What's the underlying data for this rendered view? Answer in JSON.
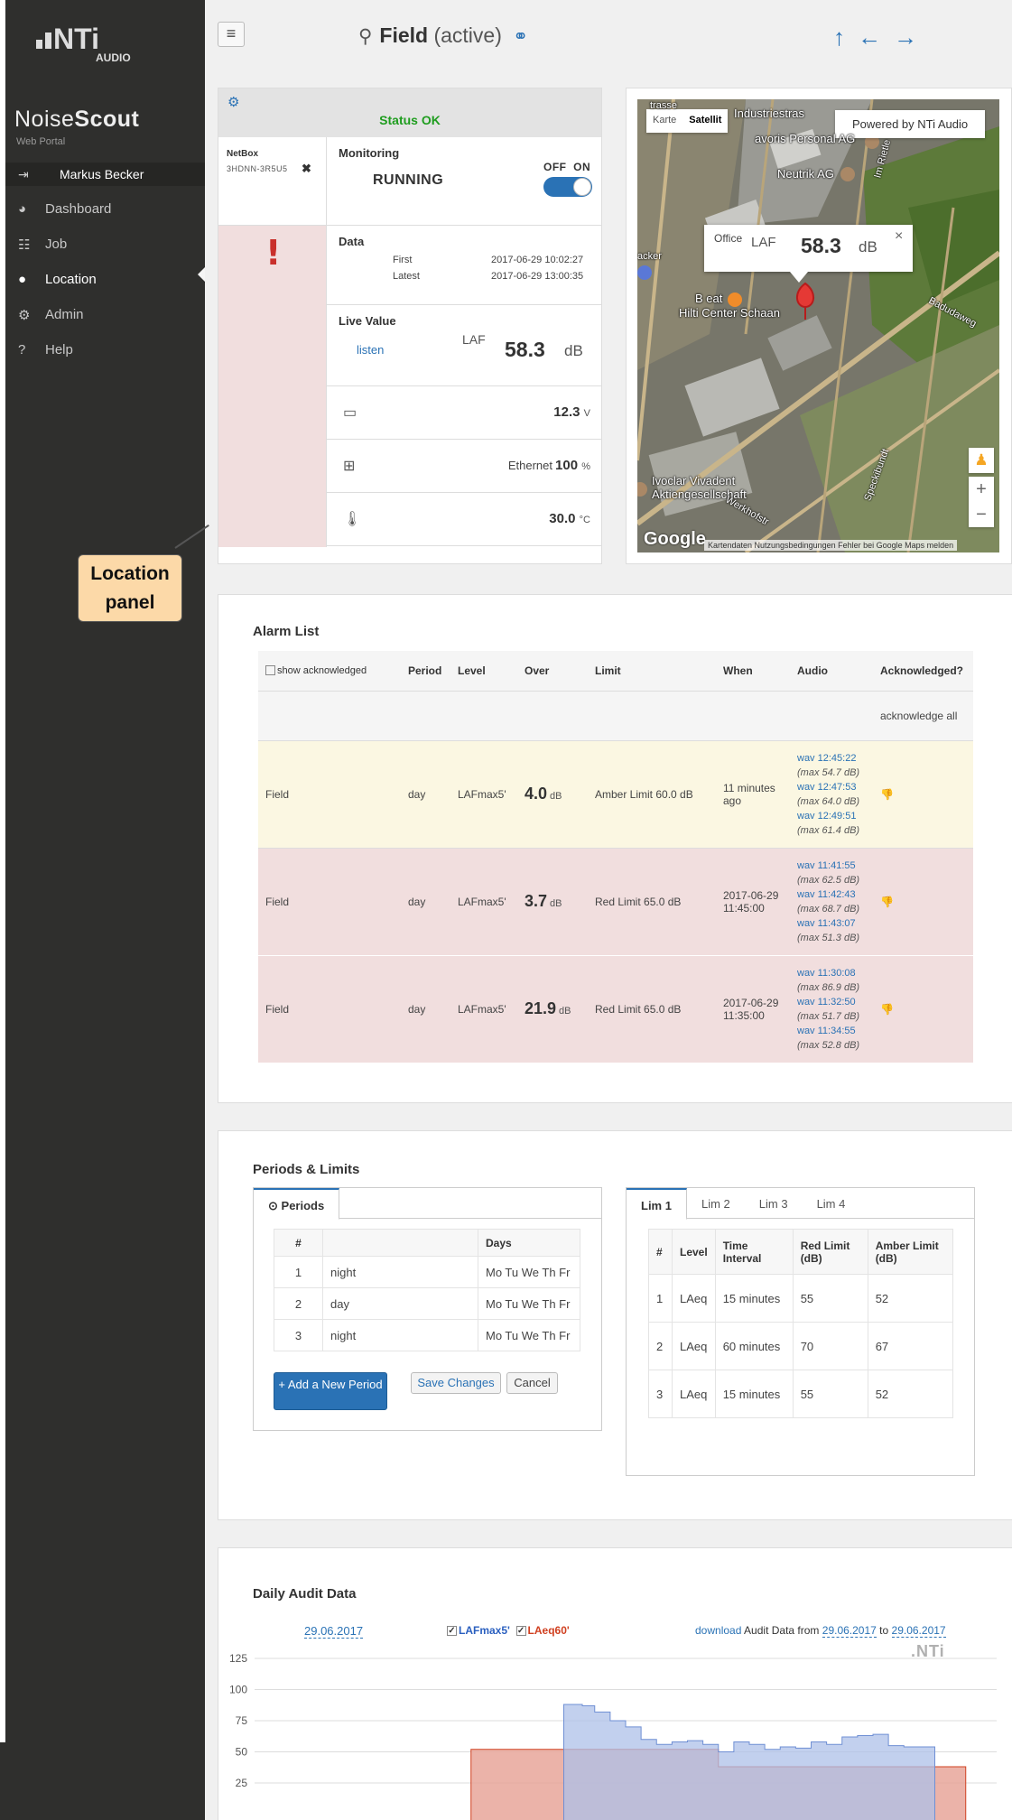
{
  "brand": {
    "logo_text": "NTi",
    "logo_sub": "AUDIO",
    "name_light": "Noise",
    "name_bold": "Scout",
    "subtitle": "Web Portal"
  },
  "user": {
    "name": "Markus Becker",
    "icon": "sign-in-icon"
  },
  "nav": {
    "items": [
      {
        "label": "Dashboard",
        "icon": "dashboard-icon"
      },
      {
        "label": "Job",
        "icon": "grid-icon"
      },
      {
        "label": "Location",
        "icon": "map-pin-icon",
        "active": true
      },
      {
        "label": "Admin",
        "icon": "gears-icon"
      },
      {
        "label": "Help",
        "icon": "question-icon"
      }
    ]
  },
  "header": {
    "title": "Field",
    "state": "(active)",
    "nav_arrows": [
      "up-arrow-icon",
      "left-arrow-icon",
      "right-arrow-icon"
    ]
  },
  "status": {
    "status_text": "Status OK",
    "netbox_label": "NetBox",
    "netbox_id": "3HDNN-3R5U5",
    "remove_icon": "✖",
    "alarm_icon": "!",
    "monitoring_label": "Monitoring",
    "monitoring_state": "RUNNING",
    "toggle_off": "OFF",
    "toggle_on": "ON",
    "toggle_value": "on",
    "data_label": "Data",
    "first_label": "First",
    "first_value": "2017-06-29 10:02:27",
    "latest_label": "Latest",
    "latest_value": "2017-06-29 13:00:35",
    "live_label": "Live Value",
    "listen_label": "listen",
    "live_metric": "LAF",
    "live_value": "58.3",
    "live_unit": "dB",
    "battery_value": "12.3",
    "battery_unit": "V",
    "network_label": "Ethernet",
    "network_value": "100",
    "network_unit": "%",
    "temp_value": "30.0",
    "temp_unit": "°C"
  },
  "map": {
    "type_map": "Karte",
    "type_sat": "Satellit",
    "powered": "Powered by NTi Audio",
    "info_name": "Office",
    "info_metric": "LAF",
    "info_value": "58.3",
    "info_unit": "dB",
    "labels": [
      "Industriestras",
      "avoris Personal AG",
      "Neutrik AG",
      "B eat",
      "Hilti Center Schaan",
      "Ivoclar Vivadent Aktiengesellschaft",
      "Badudaweg",
      "trasse",
      "acker",
      "Speckibundt",
      "Im Rietle",
      "Werkhofstr"
    ],
    "google": "Google",
    "terms": "Kartendaten   Nutzungsbedingungen   Fehler bei Google Maps melden",
    "zoom_in": "+",
    "zoom_out": "−"
  },
  "callout": {
    "line1": "Location",
    "line2": "panel"
  },
  "alarms": {
    "title": "Alarm List",
    "show_ack_label": "show acknowledged",
    "headers": [
      "Period",
      "Level",
      "Over",
      "Limit",
      "When",
      "Audio",
      "Acknowledged?"
    ],
    "ack_all": "acknowledge all",
    "rows": [
      {
        "location": "Field",
        "period": "day",
        "level": "LAFmax5'",
        "over": "4.0",
        "over_unit": "dB",
        "limit": "Amber Limit 60.0 dB",
        "when": "11 minutes ago",
        "audio": [
          {
            "wav": "wav 12:45:22",
            "max": "(max 54.7 dB)"
          },
          {
            "wav": "wav 12:47:53",
            "max": "(max 64.0 dB)"
          },
          {
            "wav": "wav 12:49:51",
            "max": "(max 61.4 dB)"
          }
        ]
      },
      {
        "location": "Field",
        "period": "day",
        "level": "LAFmax5'",
        "over": "3.7",
        "over_unit": "dB",
        "limit": "Red Limit 65.0 dB",
        "when": "2017-06-29 11:45:00",
        "audio": [
          {
            "wav": "wav 11:41:55",
            "max": "(max 62.5 dB)"
          },
          {
            "wav": "wav 11:42:43",
            "max": "(max 68.7 dB)"
          },
          {
            "wav": "wav 11:43:07",
            "max": "(max 51.3 dB)"
          }
        ]
      },
      {
        "location": "Field",
        "period": "day",
        "level": "LAFmax5'",
        "over": "21.9",
        "over_unit": "dB",
        "limit": "Red Limit 65.0 dB",
        "when": "2017-06-29 11:35:00",
        "audio": [
          {
            "wav": "wav 11:30:08",
            "max": "(max 86.9 dB)"
          },
          {
            "wav": "wav 11:32:50",
            "max": "(max 51.7 dB)"
          },
          {
            "wav": "wav 11:34:55",
            "max": "(max 52.8 dB)"
          }
        ]
      }
    ]
  },
  "periods": {
    "title": "Periods & Limits",
    "tab_label": "Periods",
    "headers": [
      "#",
      "",
      "Days"
    ],
    "rows": [
      {
        "n": "1",
        "name": "night",
        "days": "Mo Tu We Th Fr"
      },
      {
        "n": "2",
        "name": "day",
        "days": "Mo Tu We Th Fr"
      },
      {
        "n": "3",
        "name": "night",
        "days": "Mo Tu We Th Fr"
      }
    ],
    "add_btn": "+ Add a New Period",
    "save_btn": "Save Changes",
    "cancel_btn": "Cancel"
  },
  "limits": {
    "tabs": [
      "Lim 1",
      "Lim 2",
      "Lim 3",
      "Lim 4"
    ],
    "headers": [
      "#",
      "Level",
      "Time Interval",
      "Red Limit (dB)",
      "Amber Limit (dB)"
    ],
    "rows": [
      {
        "n": "1",
        "level": "LAeq",
        "interval": "15 minutes",
        "red": "55",
        "amber": "52"
      },
      {
        "n": "2",
        "level": "LAeq",
        "interval": "60 minutes",
        "red": "70",
        "amber": "67"
      },
      {
        "n": "3",
        "level": "LAeq",
        "interval": "15 minutes",
        "red": "55",
        "amber": "52"
      }
    ]
  },
  "audit": {
    "title": "Daily Audit Data",
    "date": "29.06.2017",
    "series1_label": "LAFmax5'",
    "series2_label": "LAeq60'",
    "download": "download",
    "from_text": "Audit Data from",
    "from_date": "29.06.2017",
    "to_text": "to",
    "to_date": "29.06.2017",
    "nti_mark": ".NTi"
  },
  "chart_data": {
    "type": "area",
    "yticks": [
      125,
      100,
      75,
      50,
      25
    ],
    "ylim": [
      0,
      125
    ],
    "x_range": [
      0,
      24
    ],
    "series": [
      {
        "name": "LAFmax5'",
        "color": "#aec0e8",
        "values": [
          [
            10.0,
            88
          ],
          [
            10.6,
            87
          ],
          [
            11.0,
            82
          ],
          [
            11.5,
            75
          ],
          [
            12.0,
            70
          ],
          [
            12.5,
            60
          ],
          [
            13.0,
            56
          ],
          [
            13.5,
            58
          ],
          [
            14.0,
            59
          ],
          [
            14.5,
            56
          ],
          [
            15.0,
            50
          ],
          [
            15.5,
            58
          ],
          [
            16.0,
            56
          ],
          [
            16.5,
            52
          ],
          [
            17.0,
            54
          ],
          [
            17.5,
            53
          ],
          [
            18.0,
            58
          ],
          [
            18.5,
            56
          ],
          [
            19.0,
            62
          ],
          [
            19.5,
            63
          ],
          [
            20.0,
            64
          ],
          [
            20.5,
            55
          ],
          [
            21.0,
            54
          ],
          [
            21.5,
            54
          ]
        ]
      },
      {
        "name": "LAeq60'",
        "color": "#e8a69a",
        "values": [
          [
            7.0,
            52
          ],
          [
            8.0,
            52
          ],
          [
            9.0,
            52
          ],
          [
            10.0,
            52
          ],
          [
            11.0,
            52
          ],
          [
            12.0,
            52
          ],
          [
            13.0,
            52
          ],
          [
            14.0,
            52
          ],
          [
            15.0,
            38
          ],
          [
            16.0,
            38
          ],
          [
            17.0,
            38
          ],
          [
            18.0,
            38
          ],
          [
            19.0,
            38
          ],
          [
            20.0,
            38
          ],
          [
            21.0,
            38
          ],
          [
            22.0,
            38
          ]
        ]
      }
    ]
  }
}
